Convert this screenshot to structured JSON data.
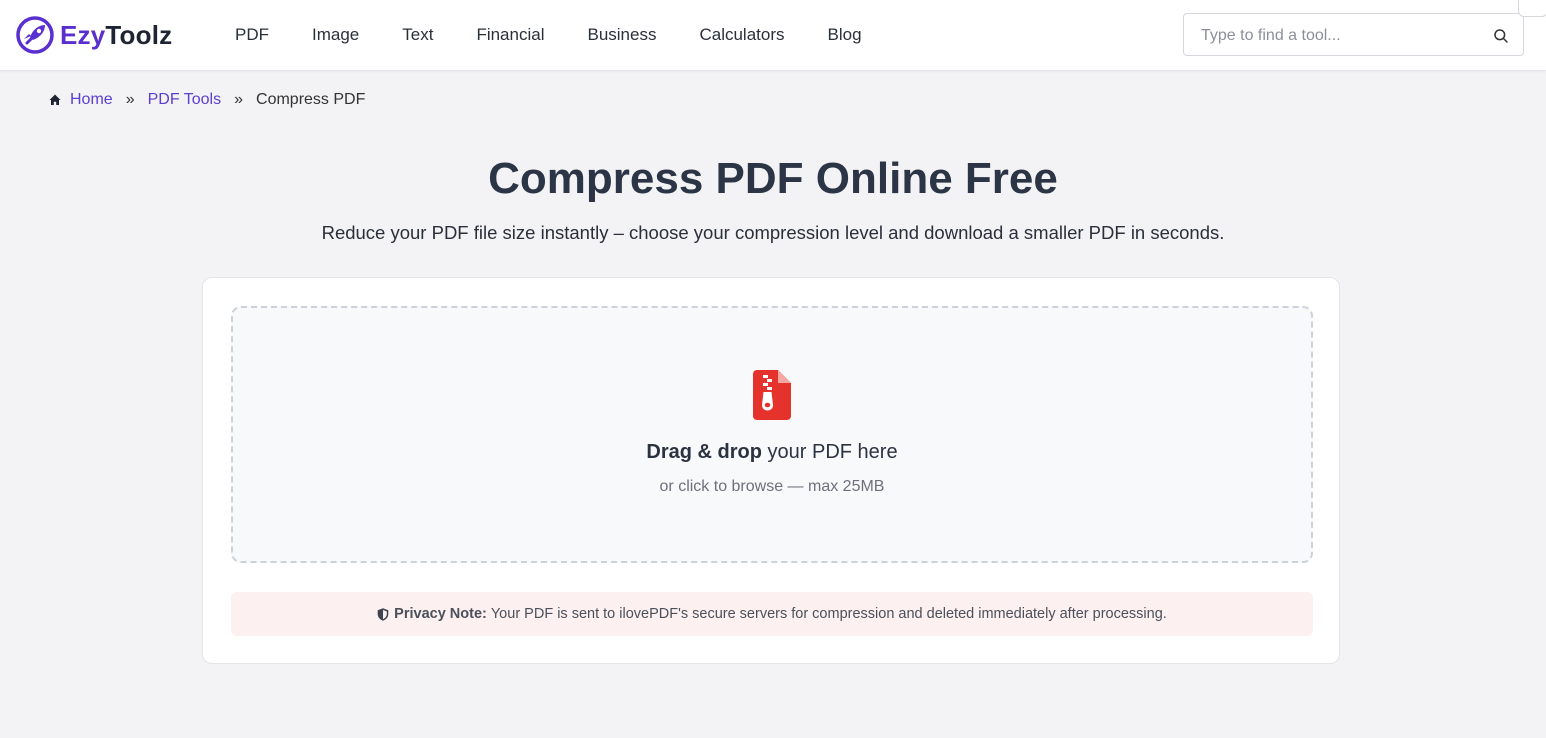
{
  "brand": {
    "name_part1": "Ezy",
    "name_part2": "Toolz",
    "accent_color": "#5a2fd0"
  },
  "nav": {
    "items": [
      {
        "label": "PDF"
      },
      {
        "label": "Image"
      },
      {
        "label": "Text"
      },
      {
        "label": "Financial"
      },
      {
        "label": "Business"
      },
      {
        "label": "Calculators"
      },
      {
        "label": "Blog"
      }
    ]
  },
  "search": {
    "placeholder": "Type to find a tool...",
    "value": "",
    "icon": "search-icon"
  },
  "breadcrumb": {
    "home_icon": "home-icon",
    "items": [
      {
        "label": "Home"
      },
      {
        "label": "PDF Tools"
      },
      {
        "label": "Compress PDF"
      }
    ],
    "separator": "»"
  },
  "main": {
    "title": "Compress PDF Online Free",
    "subtitle": "Reduce your PDF file size instantly – choose your compression level and download a smaller PDF in seconds."
  },
  "dropzone": {
    "icon": "file-zipper-icon",
    "icon_color": "#e5322d",
    "main_bold": "Drag & drop",
    "main_rest": " your PDF here",
    "sub": "or click to browse — max 25MB"
  },
  "privacy": {
    "icon": "shield-icon",
    "label": "Privacy Note:",
    "text": "Your PDF is sent to ilovePDF's secure servers for compression and deleted immediately after processing.",
    "bg_color": "#fdf0f0"
  }
}
